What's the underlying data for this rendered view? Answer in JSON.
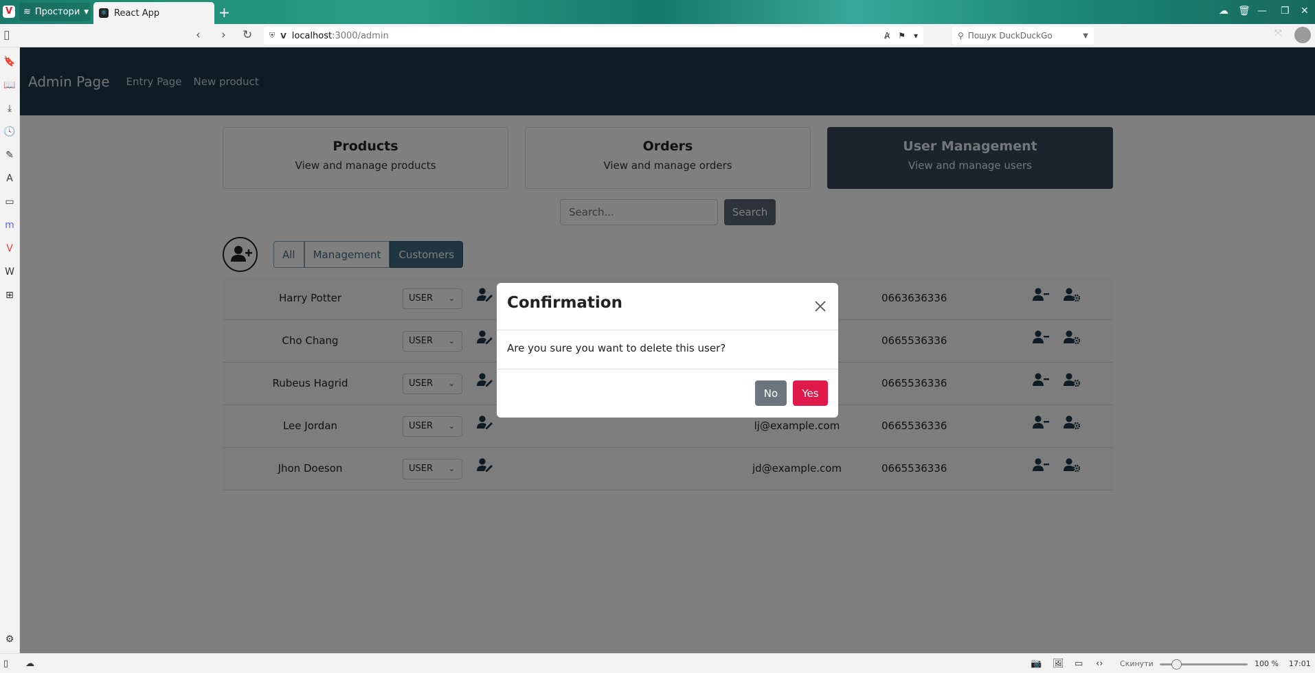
{
  "browser": {
    "workspace_label": "Простори",
    "tab_title": "React App",
    "url_host": "localhost",
    "url_path": ":3000/admin",
    "search_placeholder": "Пошук DuckDuckGo",
    "reset_label": "Скинути",
    "zoom": "100 %",
    "clock": "17:01"
  },
  "navbar": {
    "brand": "Admin Page",
    "links": [
      "Entry Page",
      "New product"
    ]
  },
  "cards": [
    {
      "title": "Products",
      "subtitle": "View and manage products",
      "active": false
    },
    {
      "title": "Orders",
      "subtitle": "View and manage orders",
      "active": false
    },
    {
      "title": "User Management",
      "subtitle": "View and manage users",
      "active": true
    }
  ],
  "search": {
    "placeholder": "Search...",
    "button_label": "Search"
  },
  "filters": [
    {
      "label": "All",
      "active": false
    },
    {
      "label": "Management",
      "active": false
    },
    {
      "label": "Customers",
      "active": true
    }
  ],
  "users": [
    {
      "name": "Harry Potter",
      "role": "USER",
      "email": "",
      "phone": "0663636336"
    },
    {
      "name": "Cho Chang",
      "role": "USER",
      "email": "",
      "phone": "0665536336"
    },
    {
      "name": "Rubeus Hagrid",
      "role": "USER",
      "email": "",
      "phone": "0665536336"
    },
    {
      "name": "Lee Jordan",
      "role": "USER",
      "email": "lj@example.com",
      "phone": "0665536336"
    },
    {
      "name": "Jhon Doeson",
      "role": "USER",
      "email": "jd@example.com",
      "phone": "0665536336"
    }
  ],
  "modal": {
    "title": "Confirmation",
    "message": "Are you sure you want to delete this user?",
    "no_label": "No",
    "yes_label": "Yes"
  },
  "colors": {
    "navbar_bg": "#1d3a4a",
    "active_card": "#39475a",
    "active_filter": "#3e6a80",
    "yes_button": "#e0194b",
    "no_button": "#6c757d"
  }
}
